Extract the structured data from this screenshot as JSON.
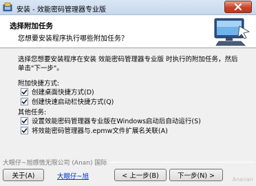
{
  "window": {
    "title": "安装 - 效能密码管理器专业版",
    "close_icon": "close-icon"
  },
  "header": {
    "title": "选择附加任务",
    "subtitle": "您想要安装程序执行哪些附加任务？"
  },
  "content": {
    "intro": "选择您想要安装程序在安装 效能密码管理器专业版 时执行的附加任务，然后单击\"下一步\"。",
    "sections": [
      {
        "title": "附加快捷方式:",
        "options": [
          {
            "label": "创建桌面快捷方式(D)",
            "checked": true
          },
          {
            "label": "创建快速启动栏快捷方式(Q)",
            "checked": true
          }
        ]
      },
      {
        "title": "其他任务:",
        "options": [
          {
            "label": "设置效能密码管理器专业版在Windows启动后自动运行(S)",
            "checked": true
          },
          {
            "label": "将效能密码管理器与.epmw文件扩展名关联(A)",
            "checked": true
          }
        ]
      }
    ]
  },
  "footer": {
    "brand": "大眼仔~旭感情无限公司 (Anan) 国际",
    "link": "大眼仔~旭",
    "buttons": {
      "about": "关于(A)",
      "back": "< 上一步(B)",
      "next": "下一步(N) >"
    },
    "watermark": "Ananan"
  }
}
